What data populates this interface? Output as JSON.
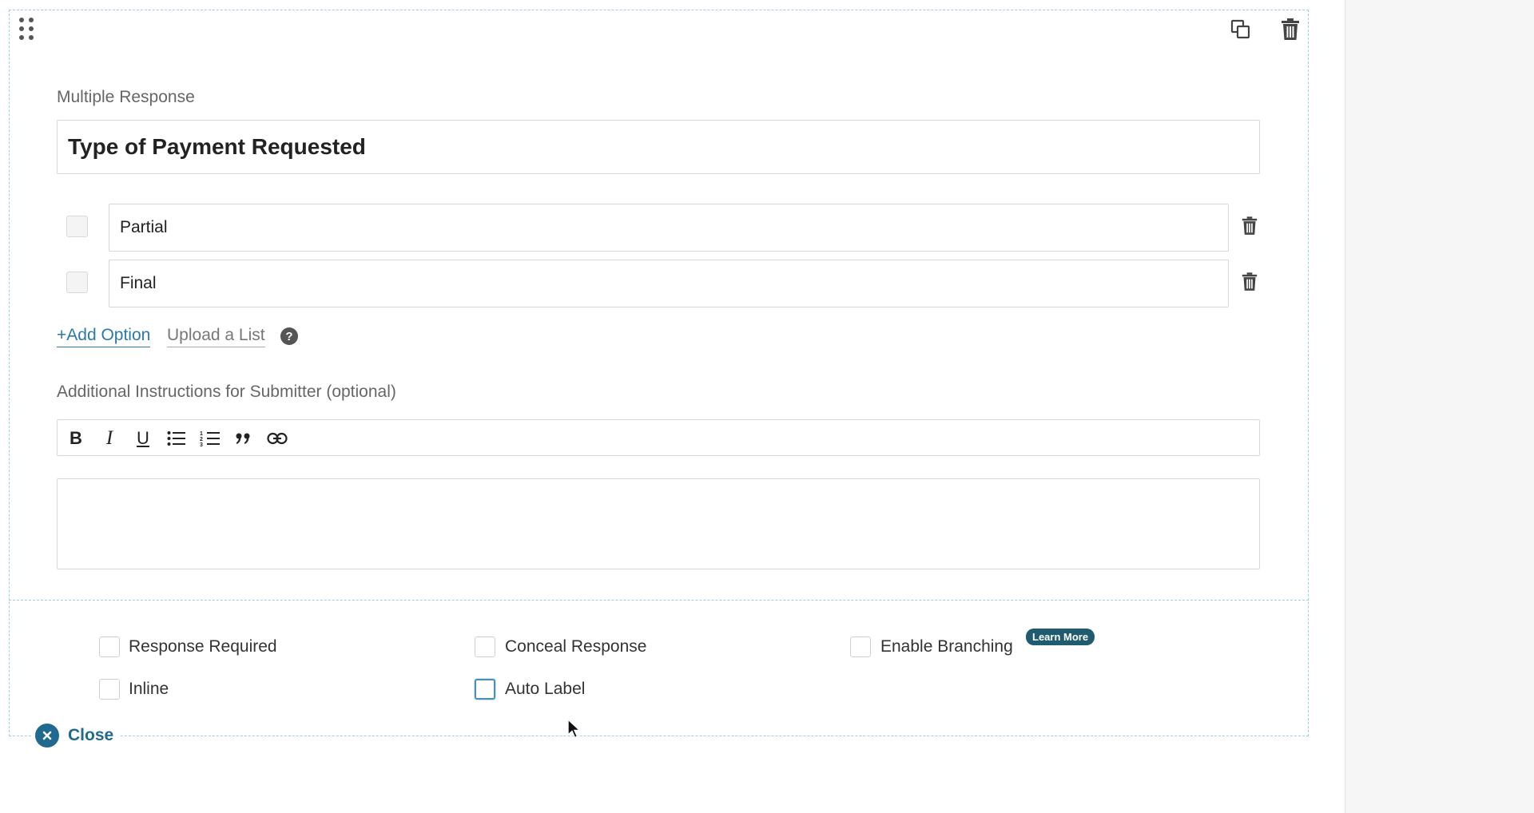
{
  "field": {
    "type_label": "Multiple Response",
    "title_value": "Type of Payment Requested"
  },
  "options": [
    {
      "value": "Partial",
      "checked": false
    },
    {
      "value": "Final",
      "checked": false
    }
  ],
  "option_actions": {
    "add_option_label": "+Add Option",
    "upload_list_label": "Upload a List",
    "help_glyph": "?"
  },
  "instructions": {
    "label": "Additional Instructions for Submitter (optional)",
    "value": "",
    "toolbar": {
      "bold": "B",
      "italic": "I",
      "underline": "U",
      "bullet_list": "bulleted-list-icon",
      "numbered_list": "numbered-list-icon",
      "quote": "quote-icon",
      "link": "link-icon"
    }
  },
  "settings": {
    "response_required": {
      "label": "Response Required",
      "checked": false
    },
    "conceal_response": {
      "label": "Conceal Response",
      "checked": false
    },
    "enable_branching": {
      "label": "Enable Branching",
      "checked": false
    },
    "learn_more": "Learn More",
    "inline": {
      "label": "Inline",
      "checked": false
    },
    "auto_label": {
      "label": "Auto Label",
      "checked": false,
      "focused": true
    }
  },
  "close_label": "Close",
  "colors": {
    "accent": "#2a7aa8",
    "close": "#1f6a8e",
    "badge": "#1f5c70",
    "dashed_border": "#9ccfe0"
  }
}
